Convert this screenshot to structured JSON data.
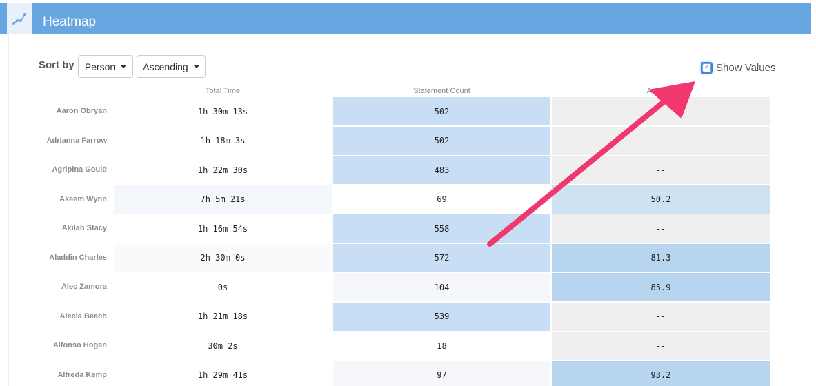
{
  "header": {
    "title": "Heatmap",
    "icon": "scatter-icon"
  },
  "controls": {
    "sort_label": "Sort by",
    "sort_field": "Person",
    "sort_order": "Ascending",
    "show_values_label": "Show Values",
    "show_values_checked": true
  },
  "chart_data": {
    "type": "heatmap",
    "columns": [
      "Total Time",
      "Statement Count",
      "Average"
    ],
    "rows": [
      {
        "name": "Aaron Obryan",
        "values": [
          "1h 30m 13s",
          "502",
          ""
        ]
      },
      {
        "name": "Adrianna Farrow",
        "values": [
          "1h 18m 3s",
          "502",
          "--"
        ]
      },
      {
        "name": "Agripina Gould",
        "values": [
          "1h 22m 30s",
          "483",
          "--"
        ]
      },
      {
        "name": "Akeem Wynn",
        "values": [
          "7h 5m 21s",
          "69",
          "50.2"
        ]
      },
      {
        "name": "Akilah Stacy",
        "values": [
          "1h 16m 54s",
          "558",
          "--"
        ]
      },
      {
        "name": "Aladdin Charles",
        "values": [
          "2h 30m 0s",
          "572",
          "81.3"
        ]
      },
      {
        "name": "Alec Zamora",
        "values": [
          "0s",
          "104",
          "85.9"
        ]
      },
      {
        "name": "Alecia Beach",
        "values": [
          "1h 21m 18s",
          "539",
          "--"
        ]
      },
      {
        "name": "Alfonso Hogan",
        "values": [
          "30m 2s",
          "18",
          "--"
        ]
      },
      {
        "name": "Alfreda Kemp",
        "values": [
          "1h 29m 41s",
          "97",
          "93.2"
        ]
      }
    ],
    "cell_colors": [
      [
        "#ffffff",
        "#c8def4",
        "#efefef"
      ],
      [
        "#ffffff",
        "#c8def4",
        "#efefef"
      ],
      [
        "#ffffff",
        "#c8def4",
        "#efefef"
      ],
      [
        "#f3f6fa",
        "#ffffff",
        "#cfe2f4"
      ],
      [
        "#ffffff",
        "#c8def4",
        "#efefef"
      ],
      [
        "#f8fafc",
        "#c8def4",
        "#b8d5f0"
      ],
      [
        "#ffffff",
        "#f5f7fa",
        "#b8d5f0"
      ],
      [
        "#ffffff",
        "#c8def4",
        "#efefef"
      ],
      [
        "#ffffff",
        "#ffffff",
        "#efefef"
      ],
      [
        "#ffffff",
        "#f5f7fa",
        "#b8d5f0"
      ]
    ]
  },
  "colors": {
    "header": "#66a7e1",
    "accent_arrow": "#f0376e"
  }
}
